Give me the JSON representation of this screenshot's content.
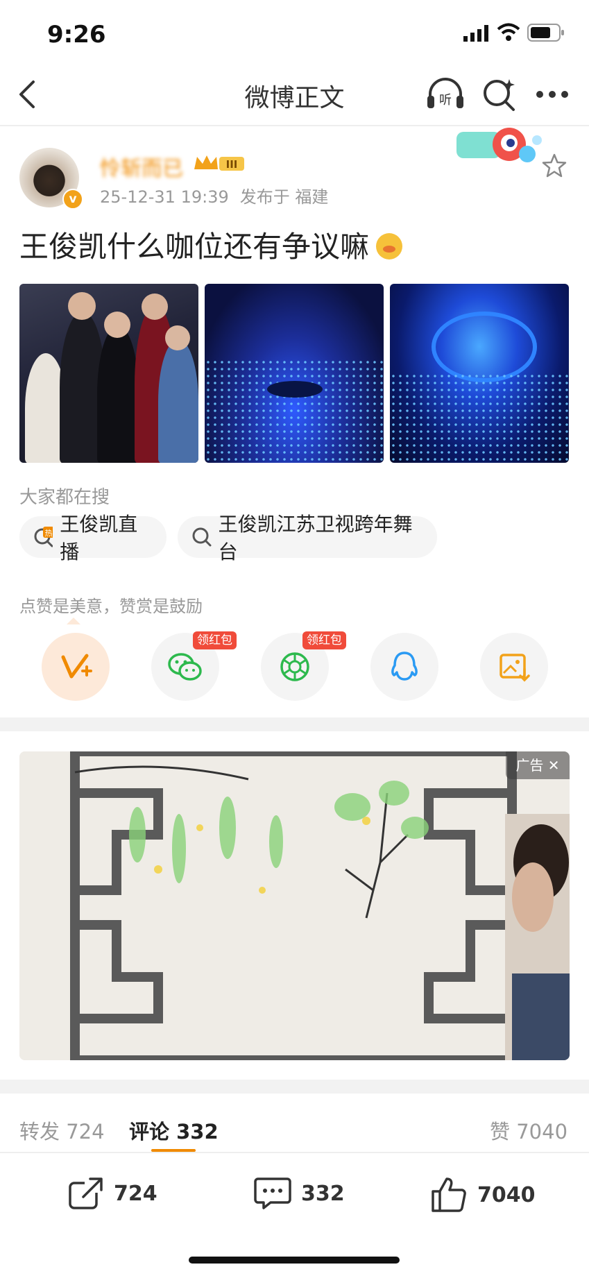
{
  "status_bar": {
    "time": "9:26"
  },
  "nav": {
    "title": "微博正文"
  },
  "post": {
    "username": "怜斩而已",
    "date": "25-12-31 19:39",
    "location": "发布于 福建",
    "text": "王俊凯什么咖位还有争议嘛",
    "verified_mark": "v",
    "level_badge": "III"
  },
  "search": {
    "label": "大家都在搜",
    "chips": [
      {
        "text": "王俊凯直播",
        "icon": "hot-search-icon"
      },
      {
        "text": "王俊凯江苏卫视跨年舞台",
        "icon": "search-icon"
      }
    ]
  },
  "reward": {
    "label": "点赞是美意，赞赏是鼓励",
    "redpack_label": "领红包",
    "share_targets": [
      "reward-v-icon",
      "wechat-icon",
      "moments-icon",
      "qq-icon",
      "save-image-icon"
    ]
  },
  "ad": {
    "tag": "广告"
  },
  "stats": {
    "repost_label": "转发",
    "repost_count": "724",
    "comment_label": "评论",
    "comment_count": "332",
    "like_label": "赞",
    "like_count": "7040"
  },
  "colors": {
    "accent": "#f08a00",
    "redpack": "#f04b3a",
    "wechat": "#2db94d",
    "qq": "#2a9af3",
    "reward_bg": "#fde9d9"
  }
}
